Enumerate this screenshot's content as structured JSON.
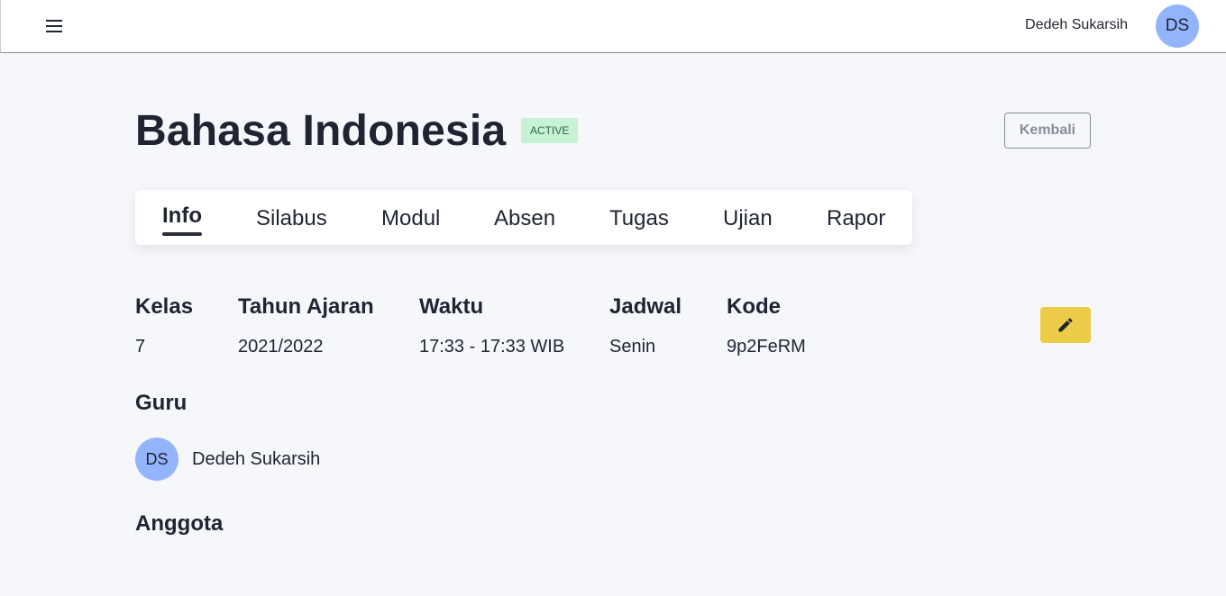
{
  "header": {
    "menu_icon": "hamburger-menu-icon",
    "user_name": "Dedeh Sukarsih",
    "avatar_initials": "DS"
  },
  "course": {
    "title": "Bahasa Indonesia",
    "status": "ACTIVE",
    "back_label": "Kembali"
  },
  "tabs": [
    {
      "label": "Info",
      "active": true
    },
    {
      "label": "Silabus"
    },
    {
      "label": "Modul"
    },
    {
      "label": "Absen"
    },
    {
      "label": "Tugas"
    },
    {
      "label": "Ujian"
    },
    {
      "label": "Rapor"
    }
  ],
  "info": {
    "columns": [
      {
        "label": "Kelas",
        "value": "7"
      },
      {
        "label": "Tahun Ajaran",
        "value": "2021/2022"
      },
      {
        "label": "Waktu",
        "value": "17:33 - 17:33 WIB"
      },
      {
        "label": "Jadwal",
        "value": "Senin"
      },
      {
        "label": "Kode",
        "value": "9p2FeRM"
      }
    ],
    "edit_icon": "pencil-icon"
  },
  "guru": {
    "heading": "Guru",
    "initials": "DS",
    "name": "Dedeh Sukarsih"
  },
  "anggota": {
    "heading": "Anggota"
  },
  "colors": {
    "background": "#f6f7fb",
    "avatar": "#93b4fb",
    "badge_bg": "#c7f2d6",
    "edit_button": "#eccb48"
  }
}
